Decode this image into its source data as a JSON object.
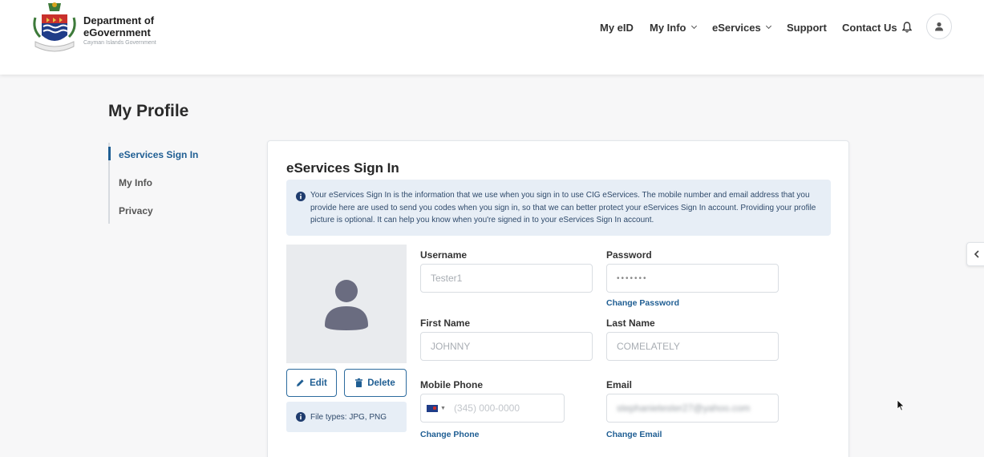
{
  "brand": {
    "line1": "Department of",
    "line2": "eGovernment",
    "line3": "Cayman Islands Government"
  },
  "nav": {
    "my_eid": "My eID",
    "my_info": "My Info",
    "eservices": "eServices",
    "support": "Support",
    "contact_us": "Contact Us"
  },
  "page": {
    "title": "My Profile"
  },
  "sidenav": {
    "items": [
      {
        "label": "eServices Sign In",
        "active": true
      },
      {
        "label": "My Info",
        "active": false
      },
      {
        "label": "Privacy",
        "active": false
      }
    ]
  },
  "card": {
    "title": "eServices Sign In",
    "info_text": "Your eServices Sign In is the information that we use when you sign in to use CIG eServices. The mobile number and email address that you provide here are used to send you codes when you sign in, so that we can better protect your eServices Sign In account. Providing your profile picture is optional. It can help you know when you're signed in to your eServices Sign In account.",
    "edit_label": "Edit",
    "delete_label": "Delete",
    "file_types": "File types: JPG, PNG"
  },
  "form": {
    "username": {
      "label": "Username",
      "value": "Tester1"
    },
    "password": {
      "label": "Password",
      "value": "•••••••",
      "link": "Change Password"
    },
    "first_name": {
      "label": "First Name",
      "value": "JOHNNY"
    },
    "last_name": {
      "label": "Last Name",
      "value": "COMELATELY"
    },
    "mobile_phone": {
      "label": "Mobile Phone",
      "placeholder": "(345) 000-0000",
      "link": "Change Phone"
    },
    "email": {
      "label": "Email",
      "value": "stephanietester27@yahoo.com",
      "link": "Change Email"
    }
  },
  "colors": {
    "accent": "#1f5e93",
    "info_bg": "#e7eef6"
  }
}
